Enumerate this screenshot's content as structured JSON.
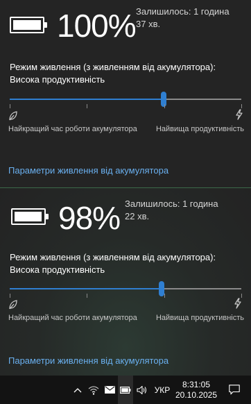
{
  "colors": {
    "accent": "#2f7fd1",
    "link": "#6ab0f0",
    "flyout_bg": "#242424",
    "taskbar_bg": "#131313"
  },
  "flyouts": [
    {
      "battery_level": 1.0,
      "percent_label": "100%",
      "remaining_line1": "Залишилось: 1 година",
      "remaining_line2": "37 хв.",
      "mode_line1": "Режим живлення (з живленням від акумулятора):",
      "mode_line2": "Висока продуктивність",
      "slider_value": 0.665,
      "slider_ticks": 4,
      "left_icon": "leaf-icon",
      "right_icon": "lightning-icon",
      "left_label": "Найкращий час роботи акумулятора",
      "right_label": "Найвища продуктивність",
      "settings_link": "Параметри живлення від акумулятора"
    },
    {
      "battery_level": 0.98,
      "percent_label": "98%",
      "remaining_line1": "Залишилось: 1 година",
      "remaining_line2": "22 хв.",
      "mode_line1": "Режим живлення (з живленням від акумулятора):",
      "mode_line2": "Висока продуктивність",
      "slider_value": 0.655,
      "slider_ticks": 4,
      "left_icon": "leaf-icon",
      "right_icon": "lightning-icon",
      "left_label": "Найкращий час роботи акумулятора",
      "right_label": "Найвища продуктивність",
      "settings_link": "Параметри живлення від акумулятора"
    }
  ],
  "taskbar": {
    "tray_icons": [
      "chevron-up-icon",
      "wifi-icon",
      "mail-icon",
      "battery-icon",
      "volume-icon"
    ],
    "language": "УКР",
    "time": "8:31:05",
    "date": "20.10.2025",
    "notification_icon": "notification-icon"
  }
}
